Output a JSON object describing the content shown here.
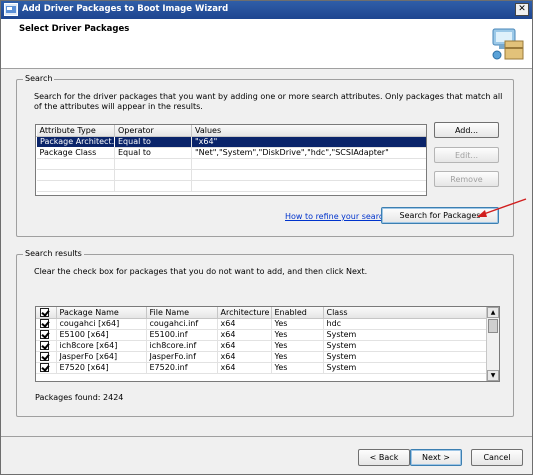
{
  "window": {
    "title": "Add Driver Packages to Boot Image Wizard",
    "close_glyph": "✕"
  },
  "header": {
    "page_title": "Select Driver Packages"
  },
  "search": {
    "legend": "Search",
    "description": "Search for the driver packages that you want by adding one or more search attributes. Only packages that match all of the attributes will appear in the results.",
    "columns": [
      "Attribute Type",
      "Operator",
      "Values"
    ],
    "rows": [
      [
        "Package Architect...",
        "Equal to",
        "\"x64\""
      ],
      [
        "Package Class",
        "Equal to",
        "\"Net\",\"System\",\"DiskDrive\",\"hdc\",\"SCSIAdapter\""
      ]
    ],
    "add_label": "Add...",
    "edit_label": "Edit...",
    "remove_label": "Remove",
    "refine_link": "How to refine your search",
    "search_button": "Search for Packages"
  },
  "results": {
    "legend": "Search results",
    "description": "Clear the check box for packages that you do not want to add, and then click Next.",
    "columns": [
      "Package Name",
      "File Name",
      "Architecture",
      "Enabled",
      "Class"
    ],
    "rows": [
      [
        "cougahci [x64]",
        "cougahci.inf",
        "x64",
        "Yes",
        "hdc"
      ],
      [
        "E5100 [x64]",
        "E5100.inf",
        "x64",
        "Yes",
        "System"
      ],
      [
        "ich8core [x64]",
        "ich8core.inf",
        "x64",
        "Yes",
        "System"
      ],
      [
        "JasperFo [x64]",
        "JasperFo.inf",
        "x64",
        "Yes",
        "System"
      ],
      [
        "E7520 [x64]",
        "E7520.inf",
        "x64",
        "Yes",
        "System"
      ]
    ],
    "found_text": "Packages found: 2424"
  },
  "footer": {
    "back_label": "< Back",
    "next_label": "Next >",
    "cancel_label": "Cancel"
  },
  "icons": {
    "scroll_up": "▲",
    "scroll_down": "▼"
  },
  "colors": {
    "title_bar": "#1e4590",
    "selection": "#0a246a",
    "annotation_arrow": "#d11f1f",
    "link": "#0033cc"
  }
}
